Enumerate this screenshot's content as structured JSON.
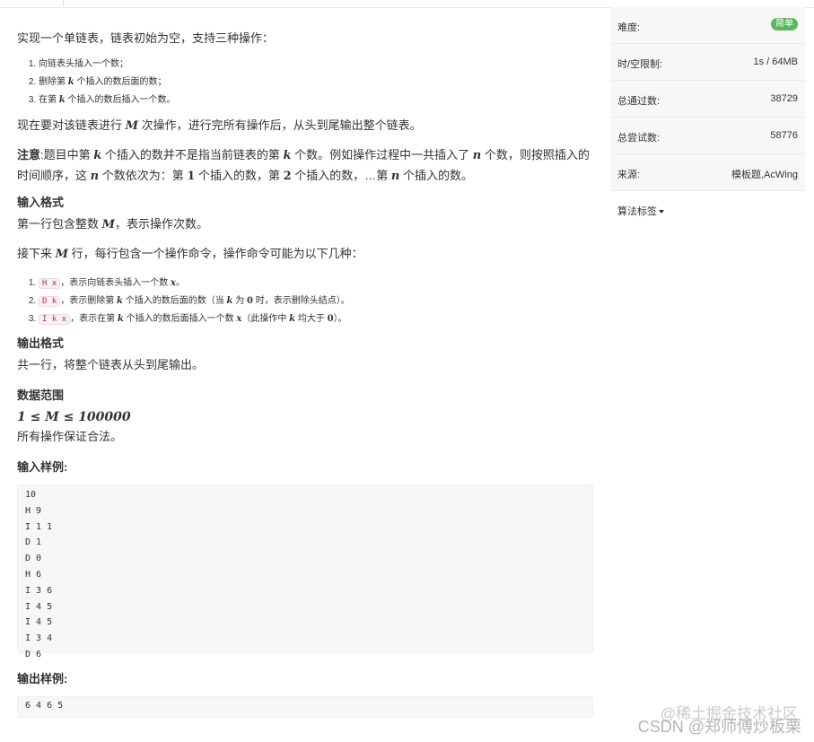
{
  "problem": {
    "intro": "实现一个单链表，链表初始为空，支持三种操作：",
    "ops": [
      "向链表头插入一个数；",
      "删除第 ",
      "个插入的数后面的数；",
      "在第 ",
      "个插入的数后插入一个数。"
    ],
    "op1": "向链表头插入一个数；",
    "op2_a": "删除第 ",
    "op2_b": " 个插入的数后面的数；",
    "op3_a": "在第 ",
    "op3_b": " 个插入的数后插入一个数。",
    "var_k": "k",
    "var_M": "M",
    "var_n": "n",
    "var_x": "x",
    "m_line_a": "现在要对该链表进行 ",
    "m_line_b": " 次操作，进行完所有操作后，从头到尾输出整个链表。",
    "note_label": "注意",
    "note_a": ":题目中第 ",
    "note_b": " 个插入的数并不是指当前链表的第 ",
    "note_c": " 个数。例如操作过程中一共插入了 ",
    "note_d": " 个数，则按照插入的时间顺序，这 ",
    "note_e": " 个数依次为：第 ",
    "num1": "1",
    "note_f": " 个插入的数，第 ",
    "num2": "2",
    "note_g": " 个插入的数，…第 ",
    "note_h": " 个插入的数。",
    "input_heading": "输入格式",
    "input_line1_a": "第一行包含整数 ",
    "input_line1_b": "，表示操作次数。",
    "input_line2_a": "接下来 ",
    "input_line2_b": " 行，每行包含一个操作命令，操作命令可能为以下几种：",
    "cmd1_code": "H x",
    "cmd1_a": "，表示向链表头插入一个数 ",
    "cmd1_b": "。",
    "cmd2_code": "D k",
    "cmd2_a": "，表示删除第 ",
    "cmd2_b": " 个插入的数后面的数（当 ",
    "cmd2_c": " 为 ",
    "num0": "0",
    "cmd2_d": " 时，表示删除头结点）。",
    "cmd3_code": "I k x",
    "cmd3_a": "，表示在第 ",
    "cmd3_b": " 个插入的数后面插入一个数 ",
    "cmd3_c": "（此操作中 ",
    "cmd3_d": " 均大于 ",
    "cmd3_e": "）。",
    "output_heading": "输出格式",
    "output_line": "共一行，将整个链表从头到尾输出。",
    "range_heading": "数据范围",
    "range_expr": "1 ≤ M ≤ 100000",
    "range_line": "所有操作保证合法。",
    "sample_in_heading": "输入样例:",
    "sample_in": "10\nH 9\nI 1 1\nD 1\nD 0\nH 6\nI 3 6\nI 4 5\nI 4 5\nI 3 4\nD 6",
    "sample_out_heading": "输出样例:",
    "sample_out": "6 4 6 5"
  },
  "sidebar": {
    "difficulty_label": "难度:",
    "difficulty_value": "简单",
    "limit_label": "时/空限制:",
    "limit_value": "1s / 64MB",
    "passed_label": "总通过数:",
    "passed_value": "38729",
    "tried_label": "总尝试数:",
    "tried_value": "58776",
    "source_label": "来源:",
    "source_value": "模板题,AcWing",
    "tags_label": "算法标签"
  },
  "watermark": {
    "line1": "@稀土掘金技术社区",
    "line2": "CSDN @郑师傅炒板栗"
  },
  "colors": {
    "badge": "#5cb85c",
    "code_text": "#c7254e",
    "code_bg": "#f9f2f4"
  }
}
